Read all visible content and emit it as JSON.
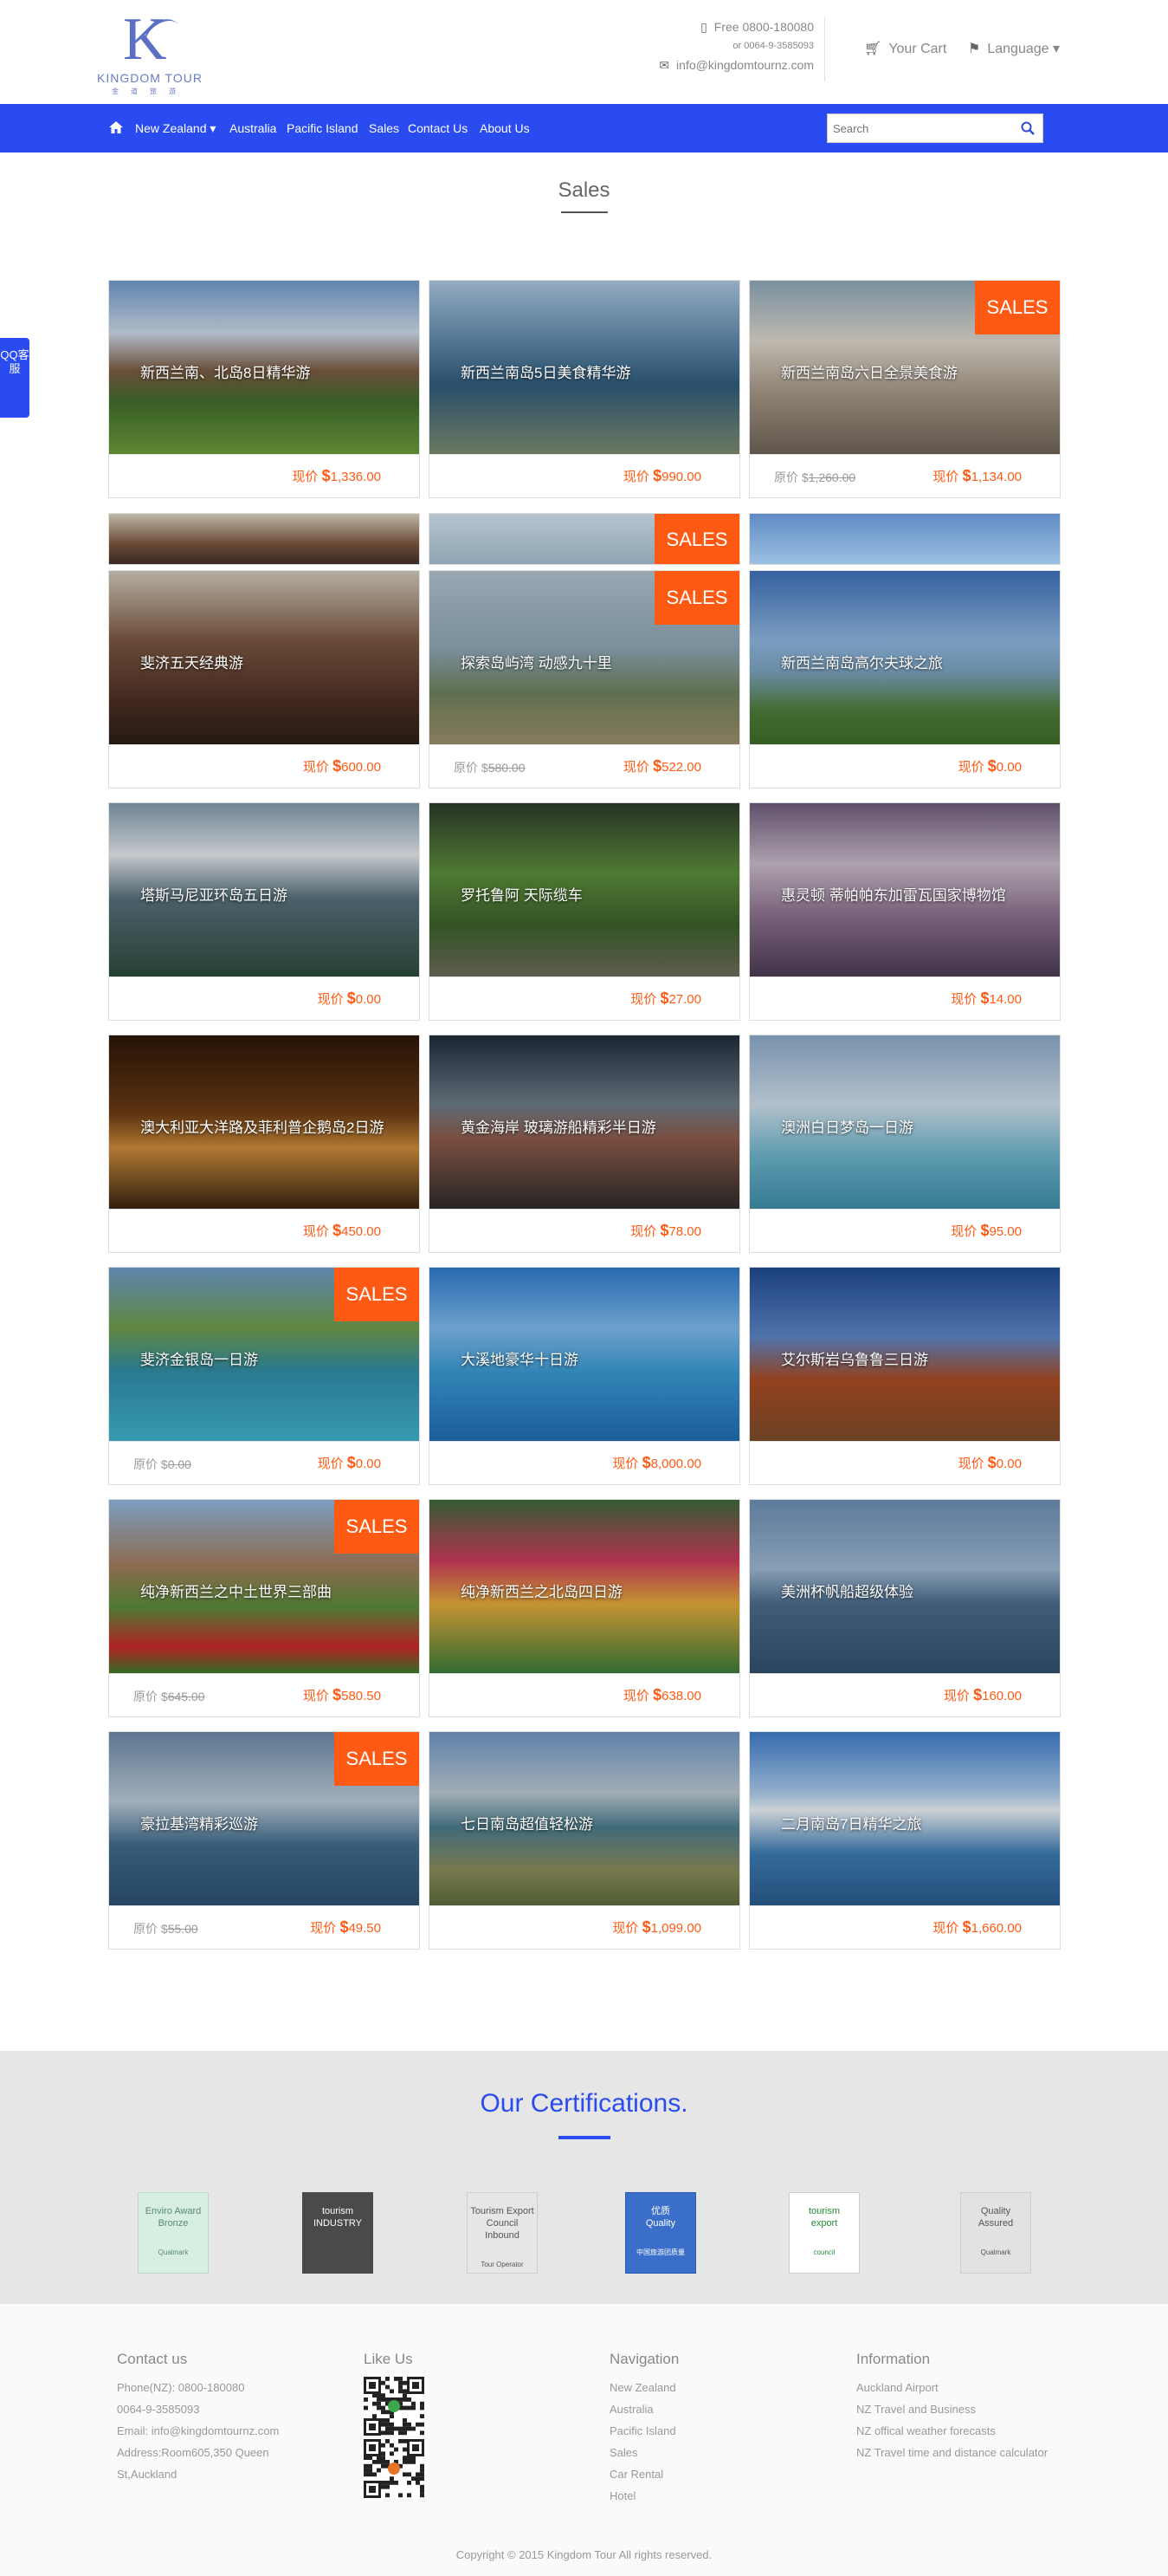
{
  "header": {
    "logo_name": "KINGDOM TOUR",
    "logo_cn": "金道旅游",
    "phone_label": "Free 0800-180080",
    "phone2": "or 0064-9-3585093",
    "email": "info@kingdomtournz.com",
    "cart_label": "Your Cart",
    "language_label": "Language",
    "icons": [
      "phone-icon",
      "mail-icon",
      "cart-icon",
      "language-icon",
      "home-icon",
      "search-icon"
    ]
  },
  "nav": {
    "items": [
      "New Zealand",
      "Australia",
      "Pacific Island",
      "Sales",
      "Contact Us",
      "About Us"
    ],
    "search_placeholder": "Search"
  },
  "page_title": "Sales",
  "qq": "QQ客服",
  "price_label": "现价",
  "orig_label": "原价",
  "currency": "$",
  "sales_badge": "SALES",
  "tours": [
    {
      "title": "新西兰南、北岛8日精华游",
      "price": "1,336.00",
      "orig": "",
      "sale": false
    },
    {
      "title": "新西兰南岛5日美食精华游",
      "price": "990.00",
      "orig": "",
      "sale": false
    },
    {
      "title": "新西兰南岛六日全景美食游",
      "price": "1,134.00",
      "orig": "1,260.00",
      "sale": true
    },
    {
      "title": "斐济五天经典游",
      "price": "600.00",
      "orig": "",
      "sale": false
    },
    {
      "title": "探索岛屿湾 动感九十里",
      "price": "522.00",
      "orig": "580.00",
      "sale": true
    },
    {
      "title": "新西兰南岛高尔夫球之旅",
      "price": "0.00",
      "orig": "",
      "sale": false
    },
    {
      "title": "塔斯马尼亚环岛五日游",
      "price": "0.00",
      "orig": "",
      "sale": false
    },
    {
      "title": "罗托鲁阿 天际缆车",
      "price": "27.00",
      "orig": "",
      "sale": false
    },
    {
      "title": "惠灵顿 蒂帕帕东加雷瓦国家博物馆",
      "price": "14.00",
      "orig": "",
      "sale": false
    },
    {
      "title": "澳大利亚大洋路及菲利普企鹅岛2日游",
      "price": "450.00",
      "orig": "",
      "sale": false
    },
    {
      "title": "黄金海岸 玻璃游船精彩半日游",
      "price": "78.00",
      "orig": "",
      "sale": false
    },
    {
      "title": "澳洲白日梦岛一日游",
      "price": "95.00",
      "orig": "",
      "sale": false
    },
    {
      "title": "斐济金银岛一日游",
      "price": "0.00",
      "orig": "0.00",
      "sale": true
    },
    {
      "title": "大溪地豪华十日游",
      "price": "8,000.00",
      "orig": "",
      "sale": false
    },
    {
      "title": "艾尔斯岩乌鲁鲁三日游",
      "price": "0.00",
      "orig": "",
      "sale": false
    },
    {
      "title": "纯净新西兰之中土世界三部曲",
      "price": "580.50",
      "orig": "645.00",
      "sale": true
    },
    {
      "title": "纯净新西兰之北岛四日游",
      "price": "638.00",
      "orig": "",
      "sale": false
    },
    {
      "title": "美洲杯帆船超级体验",
      "price": "160.00",
      "orig": "",
      "sale": false
    },
    {
      "title": "豪拉基湾精彩巡游",
      "price": "49.50",
      "orig": "55.00",
      "sale": true
    },
    {
      "title": "七日南岛超值轻松游",
      "price": "1,099.00",
      "orig": "",
      "sale": false
    },
    {
      "title": "二月南岛7日精华之旅",
      "price": "1,660.00",
      "orig": "",
      "sale": false
    }
  ],
  "certifications": {
    "title": "Our Certifications.",
    "logos": [
      {
        "line1": "Enviro Award",
        "line2": "Bronze",
        "line3": "Qualmark"
      },
      {
        "line1": "tourism",
        "line2": "INDUSTRY",
        "line3": ""
      },
      {
        "line1": "Tourism Export Council",
        "line2": "Inbound",
        "line3": "Tour Operator"
      },
      {
        "line1": "优质",
        "line2": "Quality",
        "line3": "中国旅游团质量"
      },
      {
        "line1": "tourism",
        "line2": "export",
        "line3": "council"
      },
      {
        "line1": "Quality",
        "line2": "Assured",
        "line3": "Qualmark"
      }
    ]
  },
  "footer": {
    "contact": {
      "title": "Contact us",
      "lines": [
        "Phone(NZ): 0800-180080",
        "0064-9-3585093",
        "Email: info@kingdomtournz.com",
        "Address:Room605,350 Queen",
        "St,Auckland"
      ]
    },
    "like": {
      "title": "Like Us"
    },
    "navigation": {
      "title": "Navigation",
      "links": [
        "New Zealand",
        "Australia",
        "Pacific Island",
        "Sales",
        "Car Rental",
        "Hotel"
      ]
    },
    "information": {
      "title": "Information",
      "links": [
        "Auckland Airport",
        "NZ Travel and Business",
        "NZ offical weather forecasts",
        "NZ Travel time and distance calculator"
      ]
    },
    "copyright": "Copyright © 2015 Kingdom Tour All rights reserved."
  },
  "colors": {
    "brand_blue": "#2a4bf0",
    "sale_orange": "#ff5a14"
  }
}
